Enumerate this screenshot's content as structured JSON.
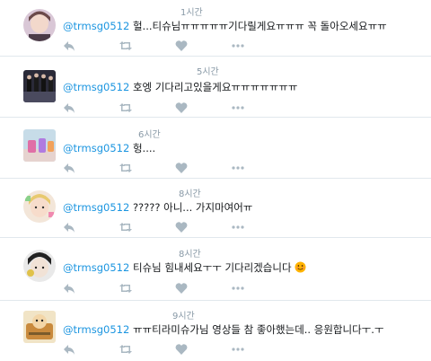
{
  "colors": {
    "mention": "#1b95e0",
    "meta": "#8899a6",
    "action_icon": "#aab8c2",
    "divider": "#e1e8ed",
    "emoji": "#ffb300"
  },
  "icons": [
    "reply-icon",
    "retweet-icon",
    "like-icon",
    "more-icon",
    "smiling-emoji-icon"
  ],
  "replies": [
    {
      "time": "1시간",
      "mention": "@trmsg0512",
      "text": "헐...티슈님ㅠㅠㅠㅠㅠ기다릴게요ㅠㅠㅠ 꼭 돌아오세요ㅠㅠ"
    },
    {
      "time": "5시간",
      "mention": "@trmsg0512",
      "text": "호엥 기다리고있을게요ㅠㅠㅠㅠㅠㅠㅠ"
    },
    {
      "time": "6시간",
      "mention": "@trmsg0512",
      "text": "헝...."
    },
    {
      "time": "8시간",
      "mention": "@trmsg0512",
      "text": "????? 아니... 가지마여어ㅠ"
    },
    {
      "time": "8시간",
      "mention": "@trmsg0512",
      "text": "티슈님 힘내세요ㅜㅜ 기다리겠습니다"
    },
    {
      "time": "9시간",
      "mention": "@trmsg0512",
      "text": "ㅠㅠ티라미슈가님 영상들 참 좋아했는데.. 응원합니다ㅜ.ㅜ"
    }
  ]
}
